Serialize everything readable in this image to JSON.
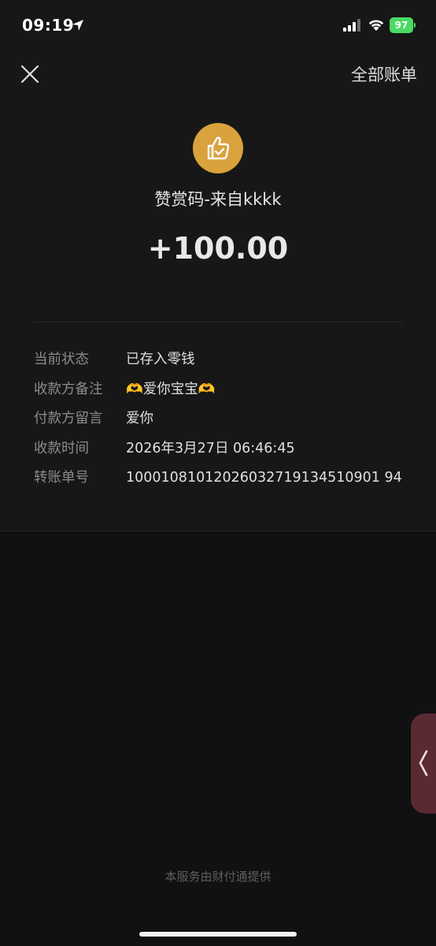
{
  "status_bar": {
    "time": "09:19",
    "battery_level": "97",
    "battery_color": "#4cd964"
  },
  "header": {
    "close_icon": "close-icon",
    "all_bills_label": "全部账单"
  },
  "summary": {
    "avatar_icon": "thumbs-up-check-icon",
    "avatar_color": "#d9a23c",
    "title": "赞赏码-来自kkkk",
    "amount": "+100.00"
  },
  "details": [
    {
      "label": "当前状态",
      "value": "已存入零钱"
    },
    {
      "label": "收款方备注",
      "value": "🫶爱你宝宝🫶"
    },
    {
      "label": "付款方留言",
      "value": "爱你"
    },
    {
      "label": "收款时间",
      "value": "2026年3月27日 06:46:45"
    },
    {
      "label": "转账单号",
      "value": "10001081012026032719134510901 94"
    }
  ],
  "side_handle": {
    "icon": "chevron-left-icon",
    "color": "#5a2a33"
  },
  "footer": {
    "note": "本服务由财付通提供"
  }
}
